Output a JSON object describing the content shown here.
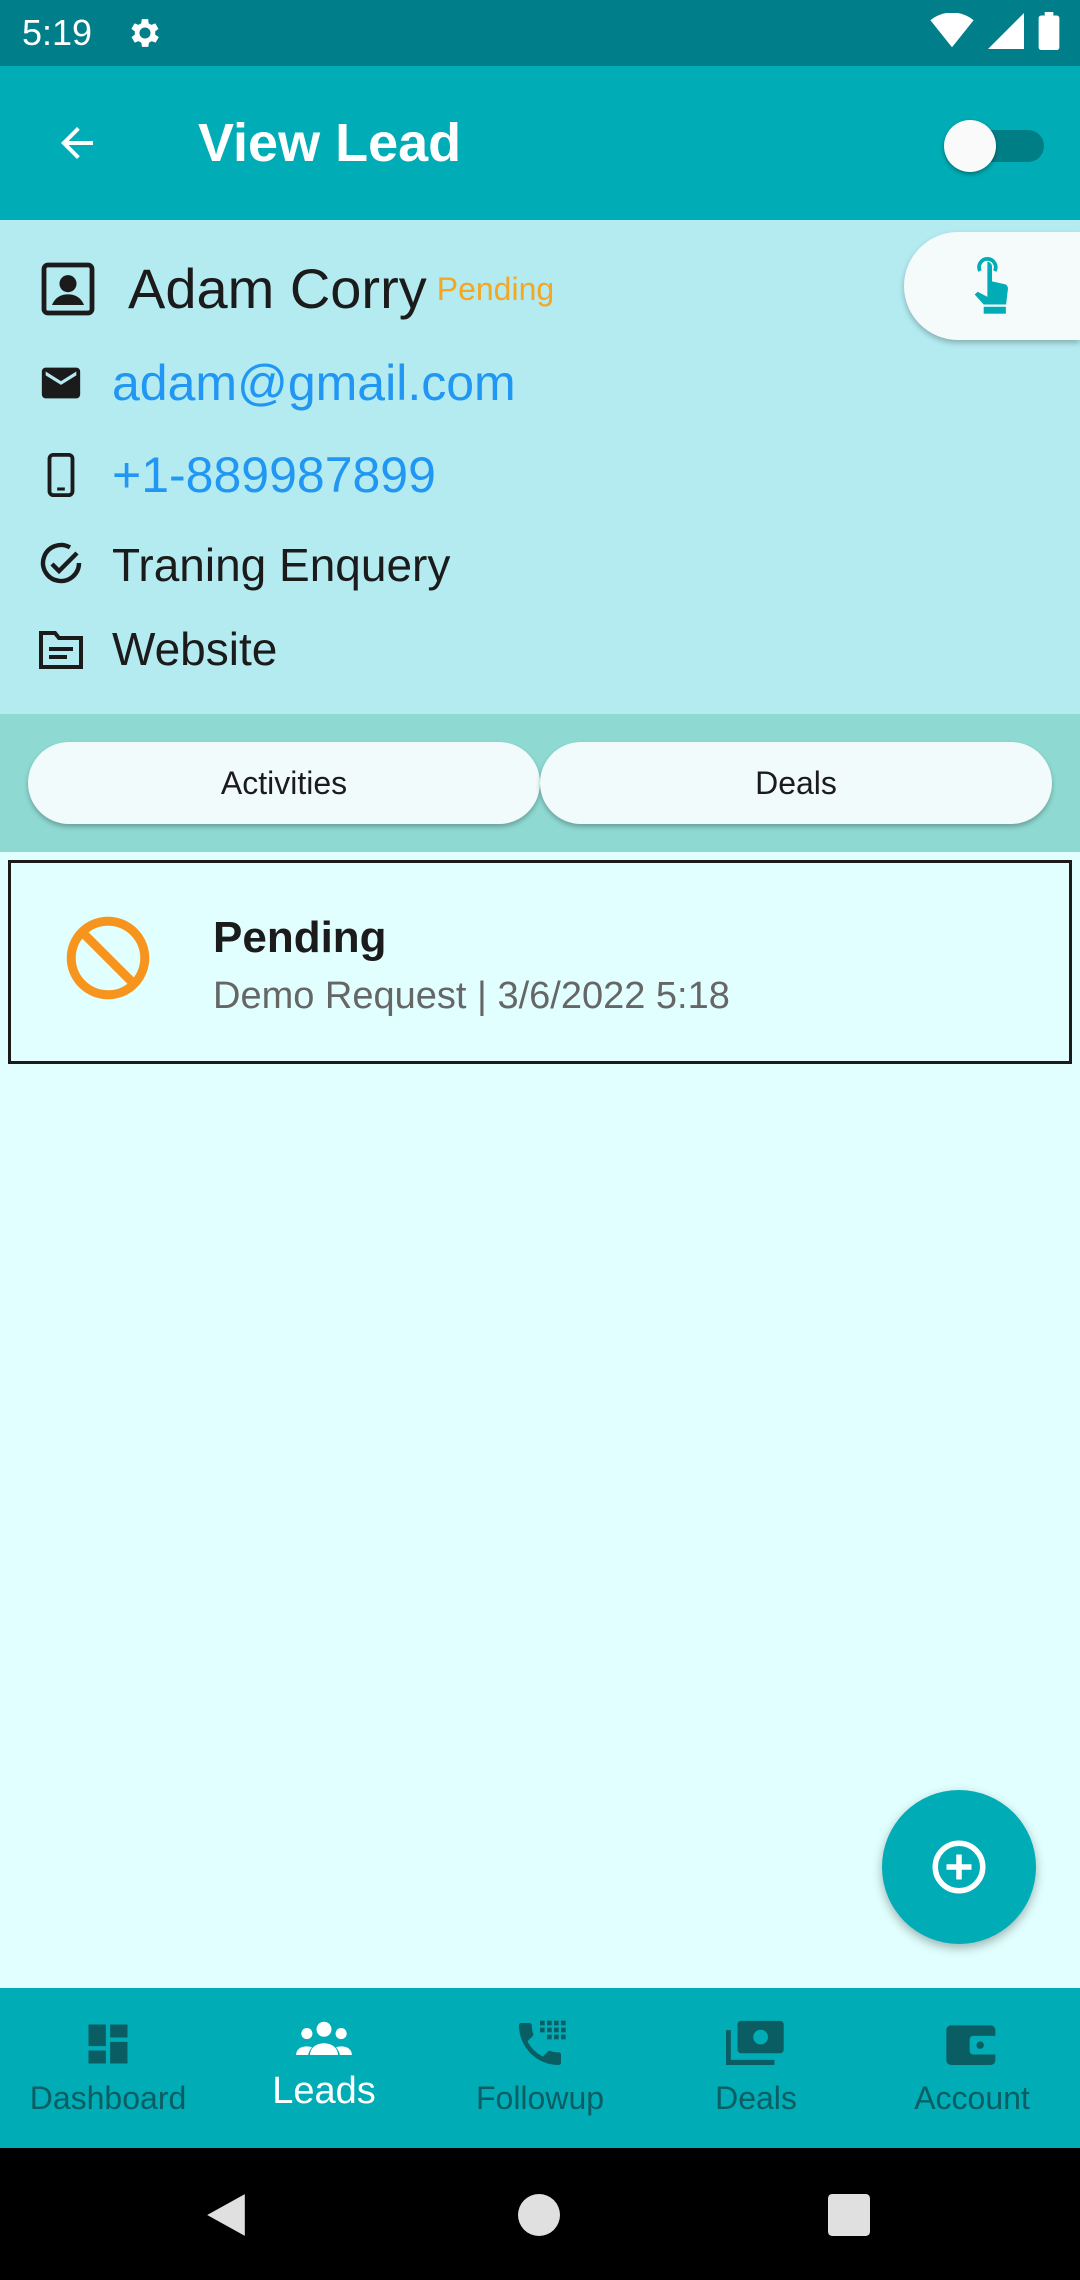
{
  "status_bar": {
    "time": "5:19"
  },
  "app_bar": {
    "title": "View Lead",
    "toggle_on": false
  },
  "lead": {
    "name": "Adam Corry",
    "status": "Pending",
    "email": "adam@gmail.com",
    "phone": "+1-889987899",
    "enquiry": "Traning Enquery",
    "source": "Website"
  },
  "tabs": [
    {
      "label": "Activities"
    },
    {
      "label": "Deals"
    }
  ],
  "activities": [
    {
      "title": "Pending",
      "subtitle": "Demo Request | 3/6/2022 5:18",
      "icon": "block-icon",
      "icon_color": "#f7941d"
    }
  ],
  "bottom_nav": [
    {
      "label": "Dashboard",
      "icon": "dashboard-icon",
      "active": false
    },
    {
      "label": "Leads",
      "icon": "people-icon",
      "active": true
    },
    {
      "label": "Followup",
      "icon": "dialpad-phone-icon",
      "active": false
    },
    {
      "label": "Deals",
      "icon": "money-icon",
      "active": false
    },
    {
      "label": "Account",
      "icon": "wallet-icon",
      "active": false
    }
  ],
  "colors": {
    "app_bar": "#00acb5",
    "status_bar": "#007f8b",
    "lead_card": "#b3ebf1",
    "tabs_bar": "#8ed9d2",
    "background": "#e0fffe",
    "link": "#2196f3",
    "pending": "#f5a623"
  }
}
